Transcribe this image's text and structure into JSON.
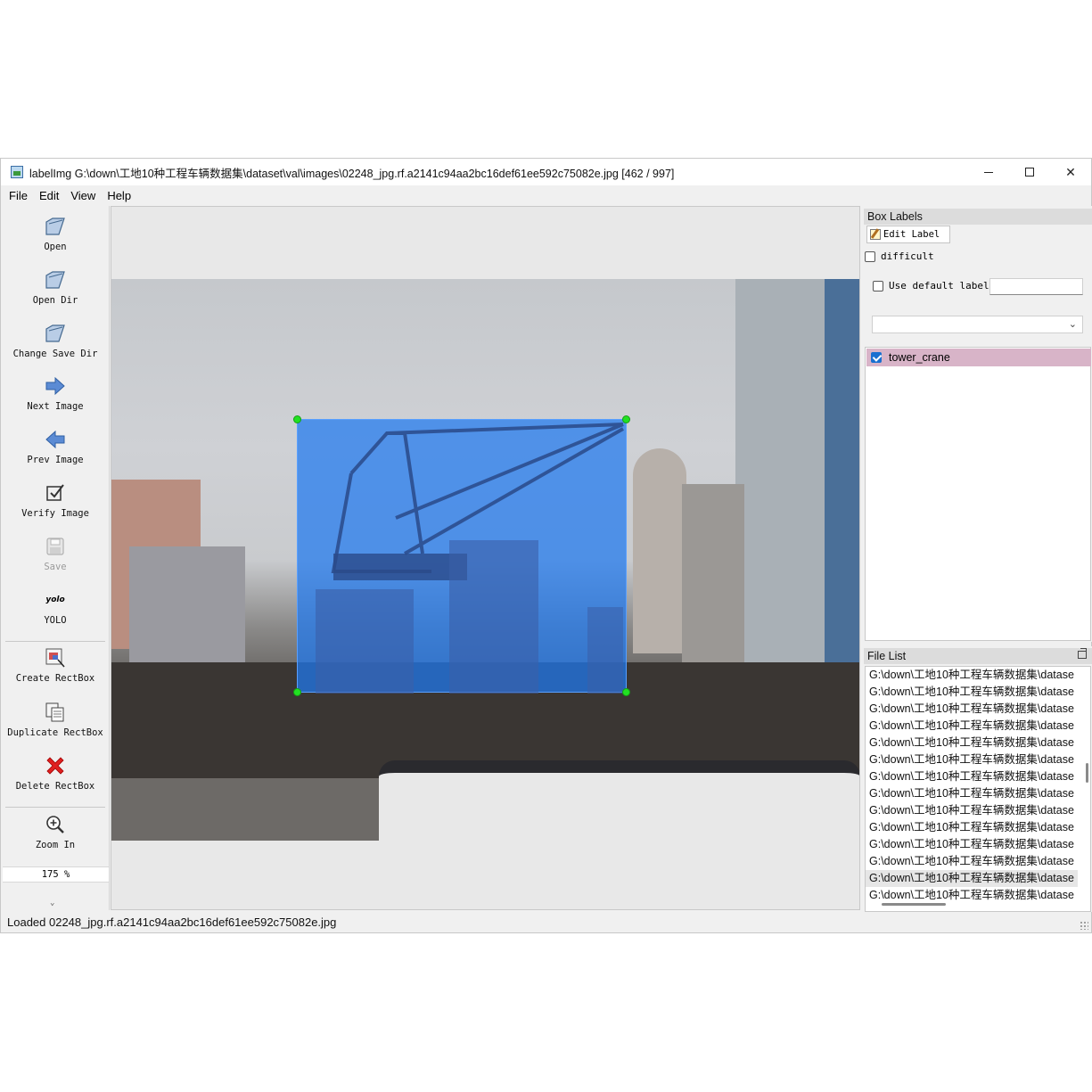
{
  "window": {
    "title": "labelImg G:\\down\\工地10种工程车辆数据集\\dataset\\val\\images\\02248_jpg.rf.a2141c94aa2bc16def61ee592c75082e.jpg [462 / 997]"
  },
  "menu": [
    "File",
    "Edit",
    "View",
    "Help"
  ],
  "toolbar": {
    "open": "Open",
    "open_dir": "Open Dir",
    "change_save_dir": "Change Save Dir",
    "next_image": "Next Image",
    "prev_image": "Prev Image",
    "verify_image": "Verify Image",
    "save": "Save",
    "yolo_icon_text": "yolo",
    "yolo": "YOLO",
    "create_rectbox": "Create RectBox",
    "duplicate_rectbox": "Duplicate RectBox",
    "delete_rectbox": "Delete RectBox",
    "zoom_in": "Zoom In",
    "zoom_value": "175 %",
    "more": "⌄"
  },
  "box_labels": {
    "title": "Box Labels",
    "edit_label": "Edit Label",
    "difficult": "difficult",
    "use_default_label": "Use default label",
    "default_label_value": "",
    "combo_value": "",
    "labels": [
      {
        "name": "tower_crane",
        "checked": true
      }
    ]
  },
  "file_list": {
    "title": "File List",
    "rows": [
      "G:\\down\\工地10种工程车辆数据集\\datase",
      "G:\\down\\工地10种工程车辆数据集\\datase",
      "G:\\down\\工地10种工程车辆数据集\\datase",
      "G:\\down\\工地10种工程车辆数据集\\datase",
      "G:\\down\\工地10种工程车辆数据集\\datase",
      "G:\\down\\工地10种工程车辆数据集\\datase",
      "G:\\down\\工地10种工程车辆数据集\\datase",
      "G:\\down\\工地10种工程车辆数据集\\datase",
      "G:\\down\\工地10种工程车辆数据集\\datase",
      "G:\\down\\工地10种工程车辆数据集\\datase",
      "G:\\down\\工地10种工程车辆数据集\\datase",
      "G:\\down\\工地10种工程车辆数据集\\datase",
      "G:\\down\\工地10种工程车辆数据集\\datase",
      "G:\\down\\工地10种工程车辆数据集\\datase"
    ],
    "selected_index": 12
  },
  "status": {
    "text": "Loaded 02248_jpg.rf.a2141c94aa2bc16def61ee592c75082e.jpg"
  },
  "colors": {
    "bbox_fill": "#1e78f0",
    "handle": "#22e022",
    "label_highlight": "#d8b4c8"
  }
}
